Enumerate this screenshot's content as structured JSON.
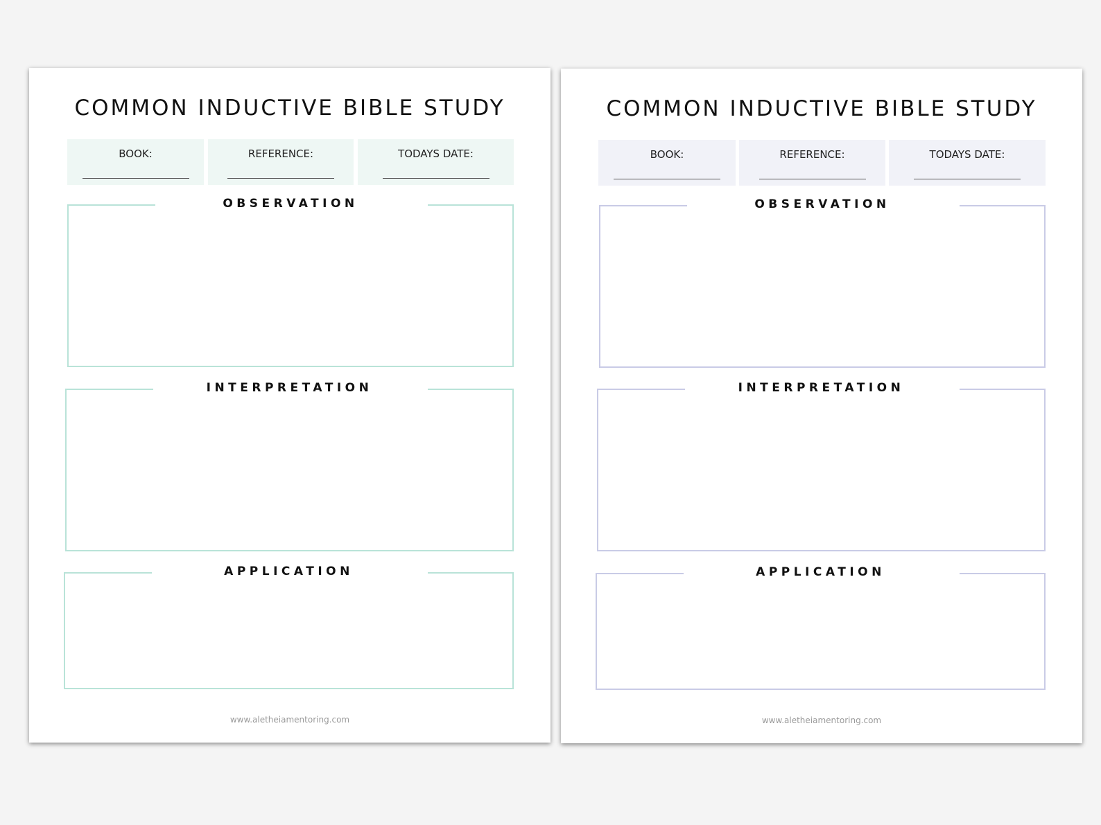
{
  "pages": [
    {
      "title": "COMMON INDUCTIVE BIBLE STUDY",
      "fields": [
        "BOOK:",
        "REFERENCE:",
        "TODAYS DATE:"
      ],
      "sections": [
        "OBSERVATION",
        "INTERPRETATION",
        "APPLICATION"
      ],
      "footer": "www.aletheiamentoring.com",
      "field_bg": "#eef7f4",
      "accent": "#b9e3d8"
    },
    {
      "title": "COMMON INDUCTIVE BIBLE STUDY",
      "fields": [
        "BOOK:",
        "REFERENCE:",
        "TODAYS DATE:"
      ],
      "sections": [
        "OBSERVATION",
        "INTERPRETATION",
        "APPLICATION"
      ],
      "footer": "www.aletheiamentoring.com",
      "field_bg": "#f1f2f8",
      "accent": "#c9cbe6"
    }
  ]
}
